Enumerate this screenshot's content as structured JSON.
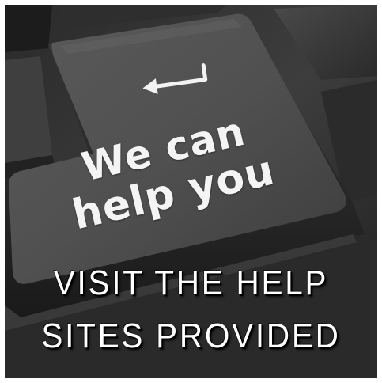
{
  "image": {
    "key_text": {
      "line1": "We can",
      "line2": "help you"
    },
    "arrow_icon": "return-arrow-icon",
    "caption": {
      "line1": "VISIT THE HELP",
      "line2": "SITES PROVIDED"
    },
    "colors": {
      "key_face": "#4a4a4a",
      "background_keys": "#2b2b2b",
      "text": "#ffffff"
    }
  }
}
